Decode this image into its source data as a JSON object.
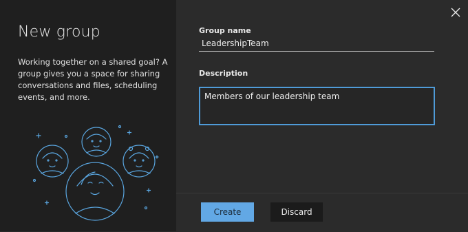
{
  "dialog": {
    "title": "New group",
    "description": "Working together on a shared goal? A group gives you a space for sharing conversations and files, scheduling events, and more."
  },
  "form": {
    "group_name_label": "Group name",
    "group_name_value": "LeadershipTeam",
    "description_label": "Description",
    "description_value": "Members of our leadership team"
  },
  "actions": {
    "create_label": "Create",
    "discard_label": "Discard"
  },
  "icons": {
    "close": "close-icon",
    "illustration": "people-group-illustration"
  },
  "colors": {
    "accent": "#62a8e5",
    "left_panel_bg": "#1f1f1f",
    "right_panel_bg": "#2b2b2b",
    "illustration_stroke": "#5aa6e0"
  }
}
